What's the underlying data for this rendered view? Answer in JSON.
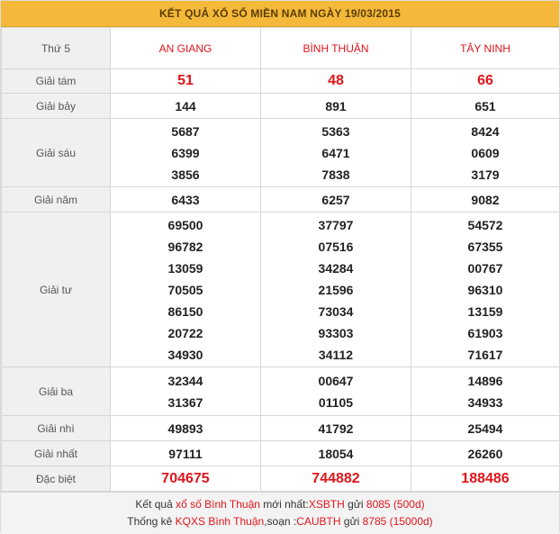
{
  "title": "KẾT QUẢ XỔ SỐ MIỀN NAM NGÀY 19/03/2015",
  "header": {
    "day": "Thứ 5",
    "provinces": [
      "AN GIANG",
      "BÌNH THUẬN",
      "TÂY NINH"
    ]
  },
  "prizes": {
    "g8": {
      "label": "Giải tám",
      "values": [
        [
          "51"
        ],
        [
          "48"
        ],
        [
          "66"
        ]
      ]
    },
    "g7": {
      "label": "Giải bảy",
      "values": [
        [
          "144"
        ],
        [
          "891"
        ],
        [
          "651"
        ]
      ]
    },
    "g6": {
      "label": "Giải sáu",
      "values": [
        [
          "5687",
          "6399",
          "3856"
        ],
        [
          "5363",
          "6471",
          "7838"
        ],
        [
          "8424",
          "0609",
          "3179"
        ]
      ]
    },
    "g5": {
      "label": "Giải năm",
      "values": [
        [
          "6433"
        ],
        [
          "6257"
        ],
        [
          "9082"
        ]
      ]
    },
    "g4": {
      "label": "Giải tư",
      "values": [
        [
          "69500",
          "96782",
          "13059",
          "70505",
          "86150",
          "20722",
          "34930"
        ],
        [
          "37797",
          "07516",
          "34284",
          "21596",
          "73034",
          "93303",
          "34112"
        ],
        [
          "54572",
          "67355",
          "00767",
          "96310",
          "13159",
          "61903",
          "71617"
        ]
      ]
    },
    "g3": {
      "label": "Giải ba",
      "values": [
        [
          "32344",
          "31367"
        ],
        [
          "00647",
          "01105"
        ],
        [
          "14896",
          "34933"
        ]
      ]
    },
    "g2": {
      "label": "Giải nhì",
      "values": [
        [
          "49893"
        ],
        [
          "41792"
        ],
        [
          "25494"
        ]
      ]
    },
    "g1": {
      "label": "Giải nhất",
      "values": [
        [
          "97111"
        ],
        [
          "18054"
        ],
        [
          "26260"
        ]
      ]
    },
    "db": {
      "label": "Đặc biệt",
      "values": [
        [
          "704675"
        ],
        [
          "744882"
        ],
        [
          "188486"
        ]
      ]
    }
  },
  "footer": {
    "line1": {
      "a": "Kết quả ",
      "b": "xổ số Bình Thuận",
      "c": " mới nhất:",
      "d": "XSBTH",
      "e": " gửi ",
      "f": "8085 (500d)"
    },
    "line2": {
      "a": "Thống kê ",
      "b": "KQXS Bình Thuận",
      "c": ",soạn :",
      "d": "CAUBTH",
      "e": " gửi ",
      "f": "8785 (15000d)"
    }
  },
  "colors": {
    "accent_bar": "#f4b93a",
    "highlight_red": "#e0151c"
  }
}
